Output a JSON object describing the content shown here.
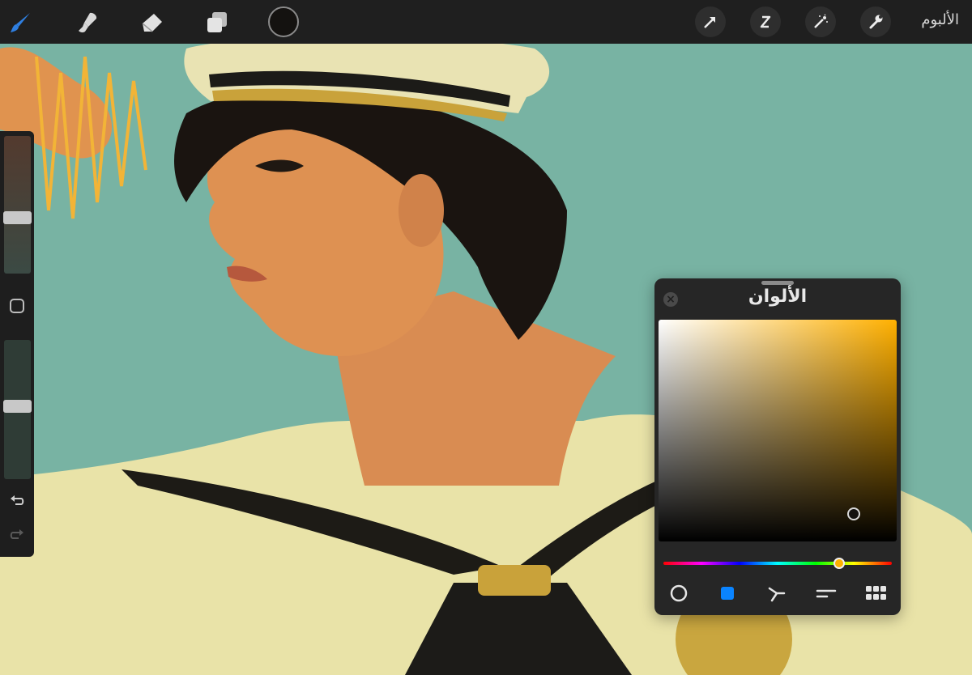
{
  "topbar": {
    "gallery_label": "الألبوم",
    "tools": [
      "brush-icon",
      "smudge-icon",
      "eraser-icon",
      "layers-icon"
    ],
    "actions": [
      "wrench-icon",
      "magic-wand-icon",
      "selection-icon",
      "transform-arrow-icon"
    ],
    "current_color": "#141210"
  },
  "sidebar": {
    "size_slider_level": 0.7,
    "opacity_slider_level": 0.55,
    "icons": [
      "modify-square-icon",
      "undo-icon",
      "redo-icon"
    ]
  },
  "color_panel": {
    "title": "الألوان",
    "hue_color": "#ffb000",
    "selected_color": "#141210",
    "hue_position": 0.77,
    "saturation": 0.82,
    "brightness": 0.08,
    "modes": [
      "disc-icon",
      "classic-square-icon",
      "harmony-icon",
      "value-sliders-icon",
      "palettes-grid-icon"
    ],
    "active_mode": "classic-square-icon",
    "accent": "#0a84ff"
  },
  "artwork": {
    "background": "#78b3a3",
    "subject": "sailor-portrait"
  }
}
